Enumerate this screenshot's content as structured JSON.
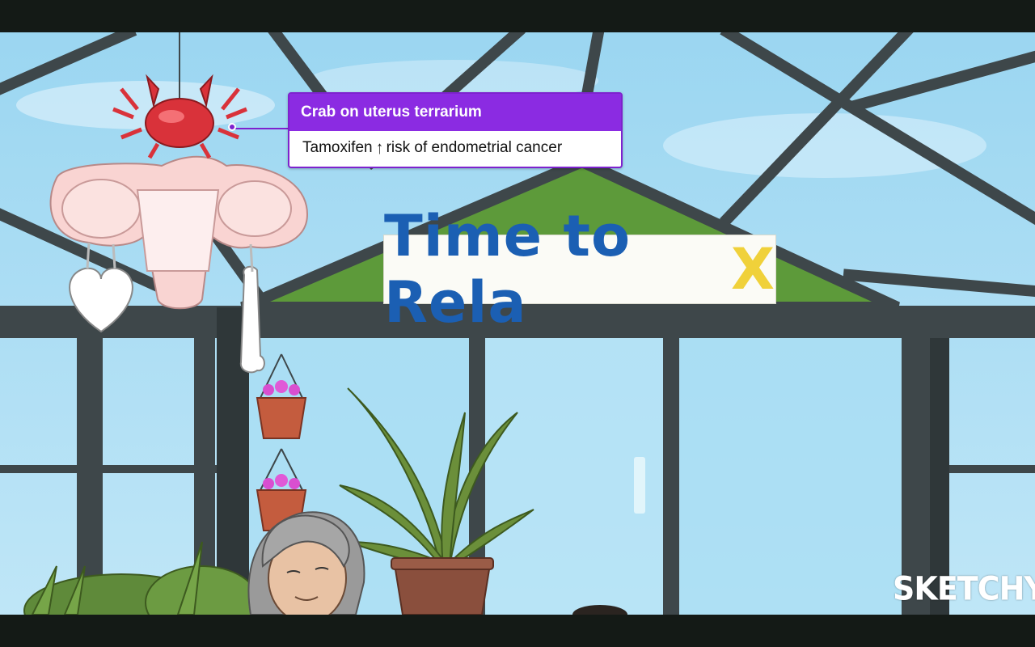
{
  "callout": {
    "title": "Crab on uterus terrarium",
    "line_before": "Tamoxifen",
    "arrow": "↑",
    "line_after": "risk of endometrial cancer"
  },
  "sign": {
    "main": "Time to Rela",
    "x": "X"
  },
  "logo": "SKETCHY",
  "icons": {
    "crab": "crab-icon",
    "uterus": "uterus-icon",
    "heart": "heart-icon",
    "bone": "bone-icon",
    "plant": "plant-icon",
    "flower_pot": "flower-pot-icon"
  },
  "colors": {
    "accent": "#8b2be2",
    "sign_text": "#1b5fb3",
    "sign_x": "#f0d13a",
    "sky": "#8fd3f0",
    "frame": "#3e474a",
    "roof": "#5d9a3a"
  }
}
